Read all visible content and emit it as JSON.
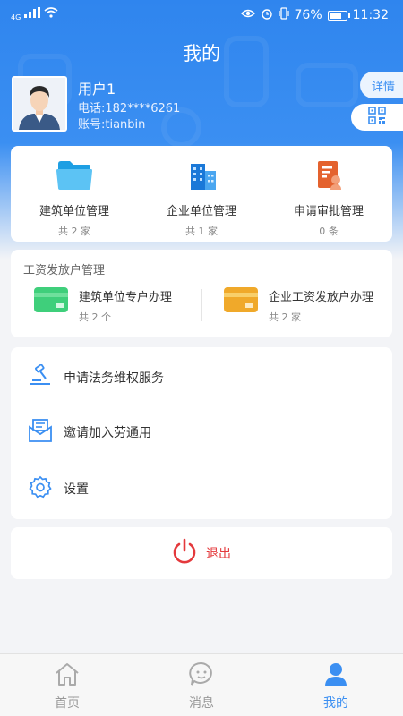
{
  "status_bar": {
    "network": "4G",
    "battery": "76%",
    "battery_level": 0.76,
    "time": "11:32"
  },
  "header": {
    "title": "我的"
  },
  "user": {
    "name": "用户1",
    "phone": "电话:182****6261",
    "account": "账号:tianbin"
  },
  "actions": {
    "detail_label": "详情",
    "qr_icon": "qr-code-icon"
  },
  "stats": [
    {
      "label": "建筑单位管理",
      "count": "共 2 家",
      "icon": "folder-icon"
    },
    {
      "label": "企业单位管理",
      "count": "共 1 家",
      "icon": "building-icon"
    },
    {
      "label": "申请审批管理",
      "count": "0 条",
      "icon": "approval-doc-icon"
    }
  ],
  "wage": {
    "title": "工资发放户管理",
    "items": [
      {
        "label": "建筑单位专户办理",
        "count": "共 2 个",
        "icon": "green-card-icon"
      },
      {
        "label": "企业工资发放户办理",
        "count": "共 2 家",
        "icon": "yellow-card-icon"
      }
    ]
  },
  "menu": [
    {
      "label": "申请法务维权服务",
      "icon": "gavel-icon"
    },
    {
      "label": "邀请加入劳通用",
      "icon": "envelope-icon"
    },
    {
      "label": "设置",
      "icon": "gear-icon"
    }
  ],
  "logout": {
    "label": "退出",
    "icon": "power-icon"
  },
  "colors": {
    "primary": "#3b8ff2",
    "danger": "#e4393c"
  },
  "tabs": [
    {
      "label": "首页",
      "icon": "home-icon",
      "active": false
    },
    {
      "label": "消息",
      "icon": "message-icon",
      "active": false
    },
    {
      "label": "我的",
      "icon": "person-icon",
      "active": true
    }
  ]
}
